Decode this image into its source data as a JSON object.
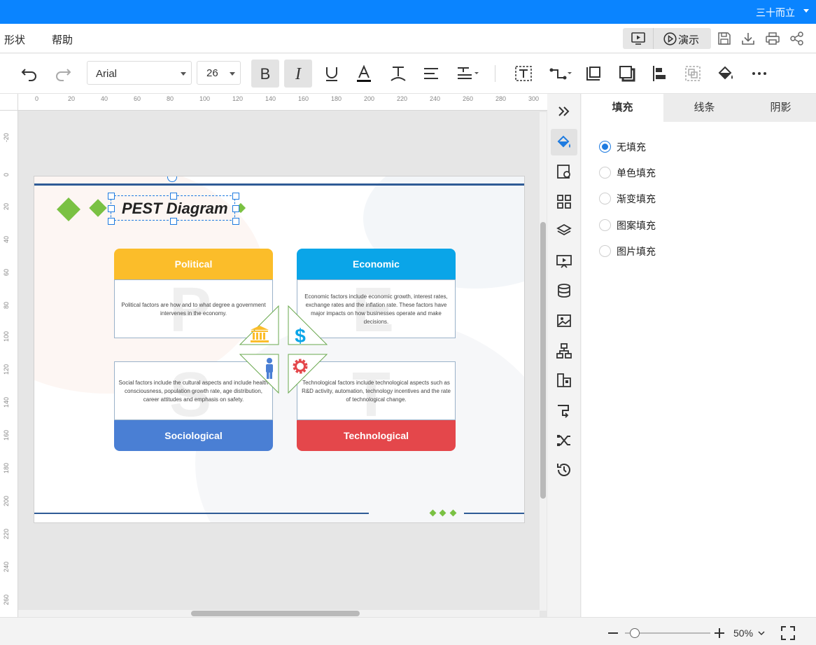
{
  "topbar": {
    "user_name": "三十而立"
  },
  "menu": {
    "shape": "形状",
    "help": "帮助",
    "present": "演示"
  },
  "toolbar": {
    "font": "Arial",
    "size": "26"
  },
  "ruler": {
    "top": [
      "0",
      "20",
      "40",
      "60",
      "80",
      "100",
      "120",
      "140",
      "160",
      "180",
      "200",
      "220",
      "240",
      "260",
      "280",
      "300"
    ],
    "left": [
      "-20",
      "0",
      "20",
      "40",
      "60",
      "80",
      "100",
      "120",
      "140",
      "160",
      "180",
      "200",
      "220",
      "240",
      "260"
    ]
  },
  "diagram": {
    "title": "PEST Diagram",
    "political": {
      "title": "Political",
      "letter": "P",
      "desc": "Political factors are how and to what degree a government intervenes in the economy."
    },
    "economic": {
      "title": "Economic",
      "letter": "E",
      "desc": "Economic factors include economic growth, interest rates, exchange rates and the inflation rate. These factors have major impacts on how businesses operate and make decisions."
    },
    "sociological": {
      "title": "Sociological",
      "letter": "S",
      "desc": "Social factors include the cultural aspects and include health consciousness, population growth rate, age distribution, career attitudes and emphasis on safety."
    },
    "technological": {
      "title": "Technological",
      "letter": "T",
      "desc": "Technological factors include technological aspects such as R&D activity, automation, technology incentives and the rate of technological change."
    },
    "colors": {
      "political": "#fbbd2a",
      "economic": "#0aa5e8",
      "sociological": "#4a7fd4",
      "technological": "#e4474b",
      "accent": "#7ac143",
      "line": "#2f5b96"
    }
  },
  "panel": {
    "tabs": [
      "填充",
      "线条",
      "阴影"
    ],
    "options": [
      "无填充",
      "单色填充",
      "渐变填充",
      "图案填充",
      "图片填充"
    ],
    "selected": 0
  },
  "status": {
    "zoom": "50%"
  }
}
